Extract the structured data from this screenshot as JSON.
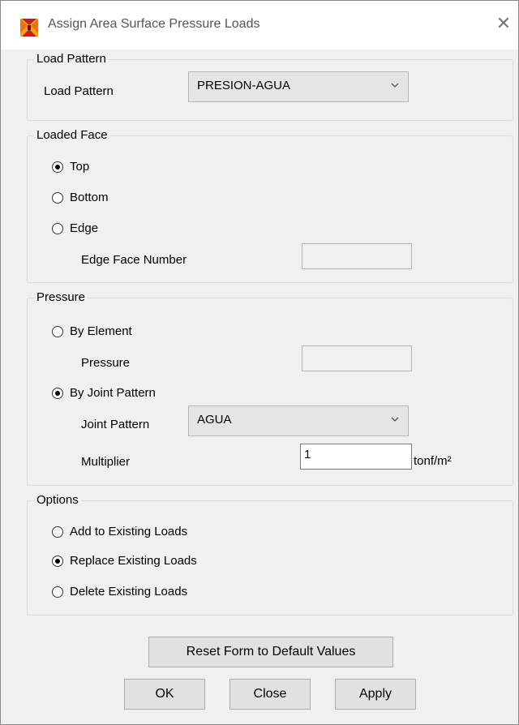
{
  "window": {
    "title": "Assign Area Surface Pressure Loads",
    "icon": "sap2000-app-icon",
    "close_glyph": "✕"
  },
  "load_pattern": {
    "group_title": "Load Pattern",
    "label": "Load Pattern",
    "selected": "PRESION-AGUA"
  },
  "loaded_face": {
    "group_title": "Loaded Face",
    "options": [
      {
        "label": "Top",
        "checked": true
      },
      {
        "label": "Bottom",
        "checked": false
      },
      {
        "label": "Edge",
        "checked": false
      }
    ],
    "edge_face_label": "Edge Face Number",
    "edge_face_value": ""
  },
  "pressure": {
    "group_title": "Pressure",
    "by_element_label": "By Element",
    "by_element_checked": false,
    "pressure_label": "Pressure",
    "pressure_value": "",
    "by_joint_label": "By Joint Pattern",
    "by_joint_checked": true,
    "joint_pattern_label": "Joint Pattern",
    "joint_pattern_selected": "AGUA",
    "multiplier_label": "Multiplier",
    "multiplier_value": "1",
    "multiplier_unit": "tonf/m²"
  },
  "options": {
    "group_title": "Options",
    "items": [
      {
        "label": "Add to Existing Loads",
        "checked": false
      },
      {
        "label": "Replace Existing Loads",
        "checked": true
      },
      {
        "label": "Delete Existing Loads",
        "checked": false
      }
    ]
  },
  "buttons": {
    "reset": "Reset Form to Default Values",
    "ok": "OK",
    "close": "Close",
    "apply": "Apply"
  },
  "colors": {
    "dialog_bg": "#f0f0f0",
    "titlebar_bg": "#ffffff",
    "button_bg": "#e1e1e1",
    "combo_bg": "#e5e5e5",
    "icon_orange": "#e8731c",
    "icon_red": "#c0201f"
  }
}
